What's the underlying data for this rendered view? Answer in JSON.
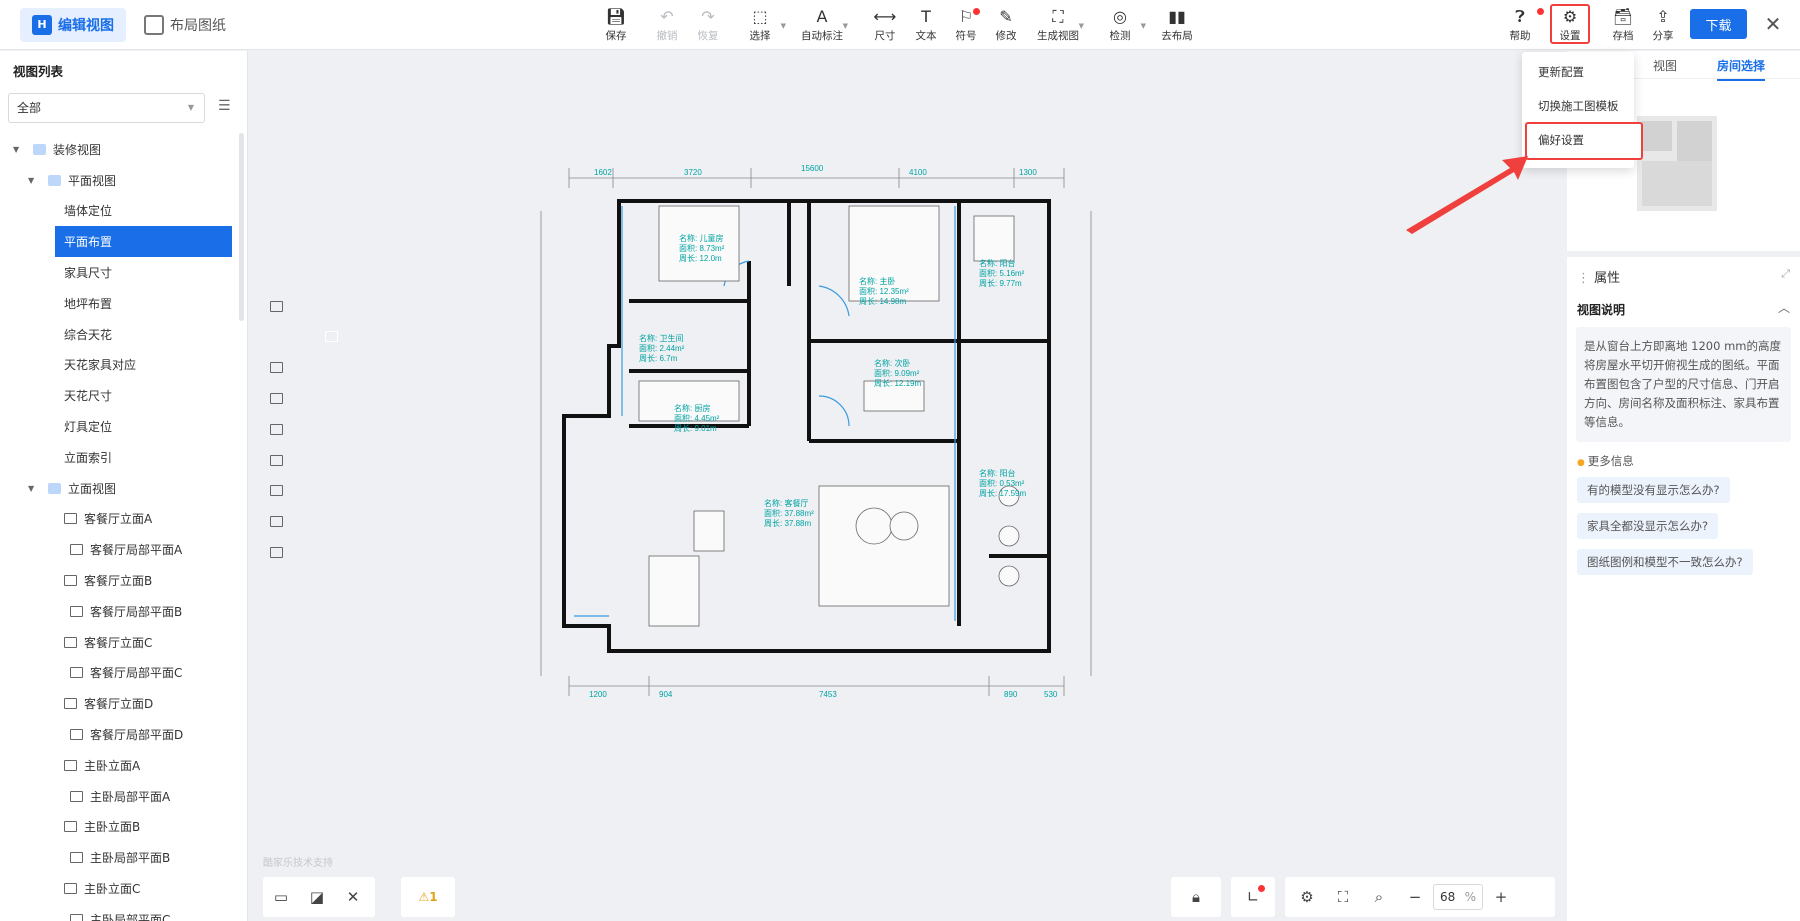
{
  "header": {
    "tabs": [
      {
        "label": "编辑视图",
        "icon": "logo-icon",
        "active": true
      },
      {
        "label": "布局图纸",
        "icon": "layout-icon",
        "active": false
      }
    ],
    "tools": {
      "save": "保存",
      "undo": "撤销",
      "redo": "恢复",
      "select": "选择",
      "auto_dimension": "自动标注",
      "dimension": "尺寸",
      "text": "文本",
      "symbol": "符号",
      "modify": "修改",
      "generate_view": "生成视图",
      "detect": "检测",
      "go_layout": "去布局",
      "help": "帮助",
      "settings": "设置",
      "archive": "存档",
      "share": "分享"
    },
    "download": "下载",
    "close_glyph": "✕"
  },
  "sidebar": {
    "title": "视图列表",
    "filter": {
      "value": "全部"
    },
    "tree": [
      {
        "label": "装修视图",
        "level": 0,
        "type": "folder",
        "expanded": true
      },
      {
        "label": "平面视图",
        "level": 1,
        "type": "folder",
        "expanded": true
      },
      {
        "label": "墙体定位",
        "level": 2,
        "type": "plan"
      },
      {
        "label": "平面布置",
        "level": 2,
        "type": "plan",
        "selected": true
      },
      {
        "label": "家具尺寸",
        "level": 2,
        "type": "plan"
      },
      {
        "label": "地坪布置",
        "level": 2,
        "type": "plan"
      },
      {
        "label": "综合天花",
        "level": 2,
        "type": "plan"
      },
      {
        "label": "天花家具对应",
        "level": 2,
        "type": "plan"
      },
      {
        "label": "天花尺寸",
        "level": 2,
        "type": "plan"
      },
      {
        "label": "灯具定位",
        "level": 2,
        "type": "plan"
      },
      {
        "label": "立面索引",
        "level": 2,
        "type": "plan"
      },
      {
        "label": "立面视图",
        "level": 1,
        "type": "folder",
        "expanded": true
      },
      {
        "label": "客餐厅立面A",
        "level": 2,
        "type": "elev"
      },
      {
        "label": "客餐厅局部平面A",
        "level": 3,
        "type": "elev"
      },
      {
        "label": "客餐厅立面B",
        "level": 2,
        "type": "elev"
      },
      {
        "label": "客餐厅局部平面B",
        "level": 3,
        "type": "elev"
      },
      {
        "label": "客餐厅立面C",
        "level": 2,
        "type": "elev"
      },
      {
        "label": "客餐厅局部平面C",
        "level": 3,
        "type": "elev"
      },
      {
        "label": "客餐厅立面D",
        "level": 2,
        "type": "elev"
      },
      {
        "label": "客餐厅局部平面D",
        "level": 3,
        "type": "elev"
      },
      {
        "label": "主卧立面A",
        "level": 2,
        "type": "elev"
      },
      {
        "label": "主卧局部平面A",
        "level": 3,
        "type": "elev"
      },
      {
        "label": "主卧立面B",
        "level": 2,
        "type": "elev"
      },
      {
        "label": "主卧局部平面B",
        "level": 3,
        "type": "elev"
      },
      {
        "label": "主卧立面C",
        "level": 2,
        "type": "elev"
      },
      {
        "label": "主卧局部平面C",
        "level": 3,
        "type": "elev"
      }
    ]
  },
  "canvas": {
    "watermark": "酷家乐技术支持",
    "dims_top": [
      "1602",
      "3720",
      "15600",
      "4100",
      "1300"
    ],
    "dims_bottom": [
      "1200",
      "904",
      "7453",
      "890",
      "530"
    ],
    "rooms": [
      {
        "name": "名称: 儿童房",
        "area": "面积: 8.73m²",
        "perim": "周长: 12.0m"
      },
      {
        "name": "名称: 主卧",
        "area": "面积: 12.35m²",
        "perim": "周长: 14.98m"
      },
      {
        "name": "名称: 阳台",
        "area": "面积: 5.16m²",
        "perim": "周长: 9.77m"
      },
      {
        "name": "名称: 卫生间",
        "area": "面积: 2.44m²",
        "perim": "周长: 6.7m"
      },
      {
        "name": "名称: 次卧",
        "area": "面积: 9.09m²",
        "perim": "周长: 12.19m"
      },
      {
        "name": "名称: 厨房",
        "area": "面积: 4.45m²",
        "perim": "周长: 9.01m"
      },
      {
        "name": "名称: 客餐厅",
        "area": "面积: 37.88m²",
        "perim": "周长: 37.88m"
      },
      {
        "name": "名称: 阳台",
        "area": "面积: 0.53m²",
        "perim": "周长: 17.59m"
      }
    ],
    "zoom": {
      "value": "68",
      "unit": "%"
    },
    "warn_count": "1"
  },
  "right_panel": {
    "minimap_tabs": [
      "视图",
      "房间选择"
    ],
    "properties_title": "属性",
    "section_title": "视图说明",
    "description": "是从窗台上方即离地 1200 mm的高度将房屋水平切开俯视生成的图纸。平面布置图包含了户型的尺寸信息、门开启方向、房间名称及面积标注、家具布置等信息。",
    "more_info": "更多信息",
    "faqs": [
      "有的模型没有显示怎么办?",
      "家具全都没显示怎么办?",
      "图纸图例和模型不一致怎么办?"
    ]
  },
  "settings_menu": {
    "items": [
      "更新配置",
      "切换施工图模板",
      "偏好设置"
    ],
    "highlighted": "偏好设置"
  },
  "colors": {
    "accent": "#1a6fe8",
    "highlight": "#f0403d",
    "dim_text": "#00a3a3"
  }
}
